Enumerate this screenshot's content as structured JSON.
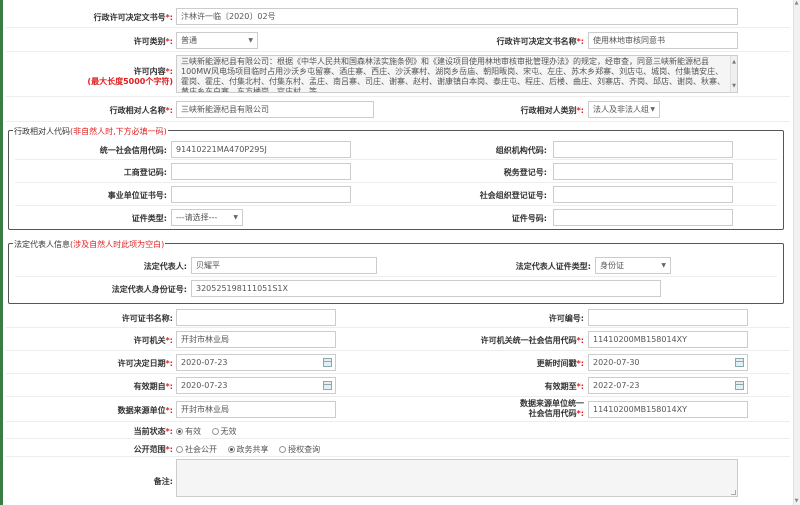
{
  "form": {
    "decision_no": {
      "label": "行政许可决定文书号",
      "value": "汴林许一临〔2020〕02号"
    },
    "license_type": {
      "label": "许可类别",
      "value": "普通"
    },
    "decision_name": {
      "label": "行政许可决定文书名称",
      "value": "使用林地审核同意书"
    },
    "content": {
      "label": "许可内容",
      "hint": "(最大长度5000个字符)",
      "value": "三峡新能源杞县有限公司：根据《中华人民共和国森林法实施条例》和《建设项目使用林地审核审批管理办法》的规定，经审查，同意三峡新能源杞县100MW风电场项目临时占用沙沃乡屯留寨、酒庄寨、西庄、沙沃寨村、湖岗乡岳庙、朝阳畈岗、宋屯、左庄、苏木乡郑寨、刘店屯、城岗、付集镇安庄、霍岗、霍庄、付集北村、付集东村、孟庄、南吕寨、司庄、谢寨、赵村、谢康镇白本岗、泰庄屯、程庄、后楼、曲庄、刘寨店、齐岗、邱店、谢岗、秋寨、黄庄乡东白寨、东方楼岗、官庄村、等"
    },
    "counterpart_name": {
      "label": "行政相对人名称",
      "value": "三峡新能源杞县有限公司"
    },
    "counterpart_type": {
      "label": "行政相对人类别",
      "value": "法人及非法人组"
    },
    "counterpart_codes": {
      "legend": "行政相对人代码",
      "legend_hint": "(非自然人时,下方必填一码)",
      "uscc": {
        "label": "统一社会信用代码:",
        "value": "91410221MA470P295J"
      },
      "org_code": {
        "label": "组织机构代码:",
        "value": ""
      },
      "business_reg": {
        "label": "工商登记码:",
        "value": ""
      },
      "tax_reg": {
        "label": "税务登记号:",
        "value": ""
      },
      "institution_cert": {
        "label": "事业单位证书号:",
        "value": ""
      },
      "social_org": {
        "label": "社会组织登记证号:",
        "value": ""
      },
      "cert_type": {
        "label": "证件类型:",
        "value": "---请选择---"
      },
      "cert_no": {
        "label": "证件号码:",
        "value": ""
      }
    },
    "legal_rep": {
      "legend": "法定代表人信息",
      "legend_hint": "(涉及自然人时此项为空白)",
      "name": {
        "label": "法定代表人:",
        "value": "贝耀平"
      },
      "id_type": {
        "label": "法定代表人证件类型:",
        "value": "身份证"
      },
      "id_no": {
        "label": "法定代表人身份证号:",
        "value": "320525198111051S1X"
      }
    },
    "cert_name": {
      "label": "许可证书名称:",
      "value": ""
    },
    "license_no": {
      "label": "许可编号:",
      "value": ""
    },
    "authority": {
      "label": "许可机关",
      "value": "开封市林业局"
    },
    "authority_uscc": {
      "label": "许可机关统一社会信用代码",
      "value": "11410200MB158014XY"
    },
    "decision_date": {
      "label": "许可决定日期",
      "value": "2020-07-23"
    },
    "update_time": {
      "label": "更新时间戳",
      "value": "2020-07-30"
    },
    "valid_from": {
      "label": "有效期自",
      "value": "2020-07-23"
    },
    "valid_to": {
      "label": "有效期至",
      "value": "2022-07-23"
    },
    "source_unit": {
      "label": "数据来源单位",
      "value": "开封市林业局"
    },
    "source_uscc": {
      "label_line1": "数据来源单位统一",
      "label_line2": "社会信用代码",
      "value": "11410200MB158014XY"
    },
    "status": {
      "label": "当前状态",
      "options": [
        "有效",
        "无效"
      ],
      "selected": "有效"
    },
    "scope": {
      "label": "公开范围",
      "options": [
        "社会公开",
        "政务共享",
        "授权查询"
      ],
      "selected": "政务共享"
    },
    "remark": {
      "label": "备注:",
      "value": ""
    }
  },
  "required_mark": "*:",
  "colon": ":",
  "colors": {
    "required": "#e02020",
    "accent": "#3a7d44",
    "border": "#cccccc"
  },
  "icons": {
    "calendar": "calendar-icon",
    "select_arrow": "chevron-down-icon"
  }
}
